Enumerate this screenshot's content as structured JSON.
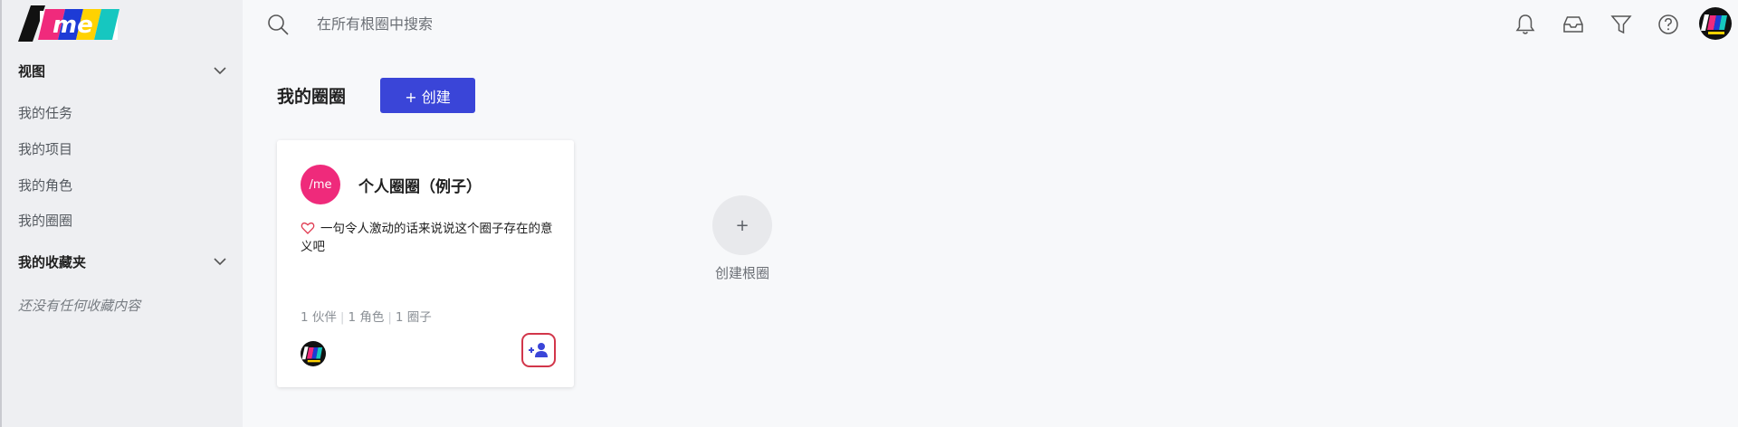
{
  "app": {
    "logo_text": "/me"
  },
  "search": {
    "placeholder": "在所有根圈中搜索"
  },
  "sidebar": {
    "sections": [
      {
        "title": "视图",
        "items": [
          "我的任务",
          "我的项目",
          "我的角色",
          "我的圈圈"
        ]
      },
      {
        "title": "我的收藏夹",
        "empty_text": "还没有任何收藏内容"
      }
    ]
  },
  "header_icons": [
    "bell-icon",
    "inbox-icon",
    "filter-icon",
    "help-icon",
    "user-avatar"
  ],
  "main": {
    "title": "我的圈圈",
    "create_button_label": "+ 创建",
    "circle_card": {
      "logo_text": "/me",
      "title": "个人圈圈（例子）",
      "description": "一句令人激动的话来说说这个圈子存在的意义吧",
      "stats": [
        "1 伙伴",
        "1 角色",
        "1 圈子"
      ]
    },
    "create_root": {
      "symbol": "+",
      "label": "创建根圈"
    }
  },
  "colors": {
    "accent": "#3a45d8",
    "circle_logo": "#ef2a7b",
    "add_member_border": "#d2364a",
    "sidebar_bg": "#eeeff2"
  }
}
